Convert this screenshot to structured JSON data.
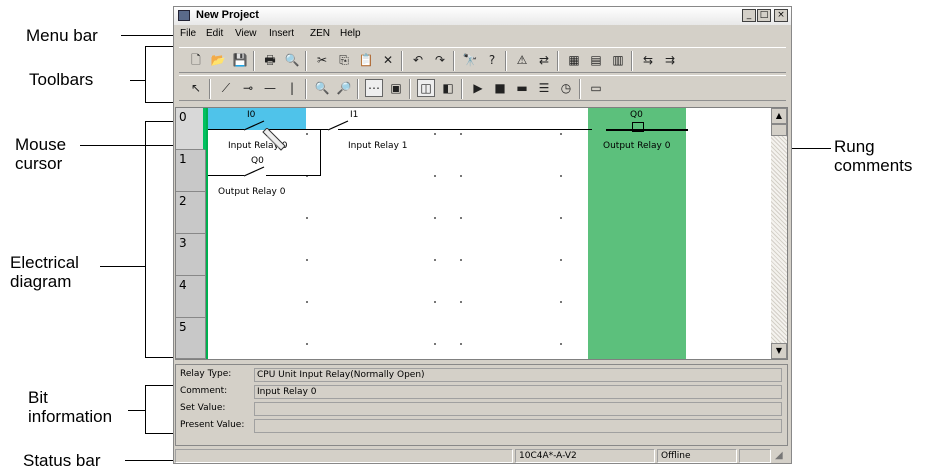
{
  "annotations": {
    "menu_bar": "Menu bar",
    "toolbars": "Toolbars",
    "mouse_cursor": [
      "Mouse",
      "cursor"
    ],
    "electrical_diagram": [
      "Electrical",
      "diagram"
    ],
    "bit_information": [
      "Bit",
      "information"
    ],
    "status_bar": "Status bar",
    "rung_comments": [
      "Rung",
      "comments"
    ]
  },
  "window": {
    "title": "New Project",
    "controls": [
      "_",
      "□",
      "×"
    ]
  },
  "menu": [
    "File",
    "Edit",
    "View",
    "Insert",
    "ZEN",
    "Help"
  ],
  "toolbar1": [
    {
      "icon": "new-file-icon",
      "glyph": "🗋"
    },
    {
      "icon": "open-folder-icon",
      "glyph": "📂"
    },
    {
      "icon": "save-icon",
      "glyph": "💾"
    },
    {
      "icon": "print-icon",
      "glyph": "🖶"
    },
    {
      "icon": "print-preview-icon",
      "glyph": "🔍"
    },
    {
      "icon": "cut-icon",
      "glyph": "✂"
    },
    {
      "icon": "copy-icon",
      "glyph": "⎘"
    },
    {
      "icon": "paste-icon",
      "glyph": "📋"
    },
    {
      "icon": "delete-icon",
      "glyph": "✕"
    },
    {
      "icon": "undo-icon",
      "glyph": "↶"
    },
    {
      "icon": "redo-icon",
      "glyph": "↷"
    },
    {
      "icon": "find-icon",
      "glyph": "🔭"
    },
    {
      "icon": "help-icon",
      "glyph": "?"
    },
    {
      "icon": "warning-icon",
      "glyph": "⚠"
    },
    {
      "icon": "transfer-icon",
      "glyph": "⇄"
    },
    {
      "icon": "module-icon",
      "glyph": "▦"
    },
    {
      "icon": "compare-icon",
      "glyph": "▤"
    },
    {
      "icon": "verify-icon",
      "glyph": "▥"
    },
    {
      "icon": "connect-icon",
      "glyph": "⇆"
    },
    {
      "icon": "disconnect-icon",
      "glyph": "⇉"
    }
  ],
  "toolbar2": [
    {
      "icon": "select-pointer-icon",
      "glyph": "↖"
    },
    {
      "icon": "contact-icon",
      "glyph": "⟋"
    },
    {
      "icon": "coil-icon",
      "glyph": "⊸"
    },
    {
      "icon": "horizontal-line-icon",
      "glyph": "—"
    },
    {
      "icon": "vertical-line-icon",
      "glyph": "|"
    },
    {
      "icon": "zoom-in-icon",
      "glyph": "🔍"
    },
    {
      "icon": "zoom-out-icon",
      "glyph": "🔎"
    },
    {
      "icon": "grid-icon",
      "glyph": "⋯"
    },
    {
      "icon": "comment-view-icon",
      "glyph": "▣"
    },
    {
      "icon": "ladder-view-icon",
      "glyph": "◫"
    },
    {
      "icon": "list-view-icon",
      "glyph": "◧"
    },
    {
      "icon": "run-icon",
      "glyph": "▶"
    },
    {
      "icon": "stop-icon",
      "glyph": "■"
    },
    {
      "icon": "monitor-icon",
      "glyph": "▬"
    },
    {
      "icon": "table-icon",
      "glyph": "☰"
    },
    {
      "icon": "timer-icon",
      "glyph": "◷"
    },
    {
      "icon": "screen-icon",
      "glyph": "▭"
    }
  ],
  "rungs": [
    "0",
    "1",
    "2",
    "3",
    "4",
    "5"
  ],
  "diagram": {
    "i0_addr": "I0",
    "i0_comment": "Input Relay 0",
    "i1_addr": "I1",
    "i1_comment": "Input Relay 1",
    "q0_contact_addr": "Q0",
    "q0_contact_comment": "Output Relay 0",
    "q0_coil_addr": "Q0",
    "q0_coil_comment": "Output Relay 0"
  },
  "bit_info": {
    "relay_type_label": "Relay Type:",
    "relay_type_value": "CPU Unit Input Relay(Normally Open)",
    "comment_label": "Comment:",
    "comment_value": "Input Relay 0",
    "set_value_label": "Set Value:",
    "set_value_value": "",
    "present_value_label": "Present Value:",
    "present_value_value": ""
  },
  "status": {
    "model": "10C4A*-A-V2",
    "connection": "Offline"
  }
}
